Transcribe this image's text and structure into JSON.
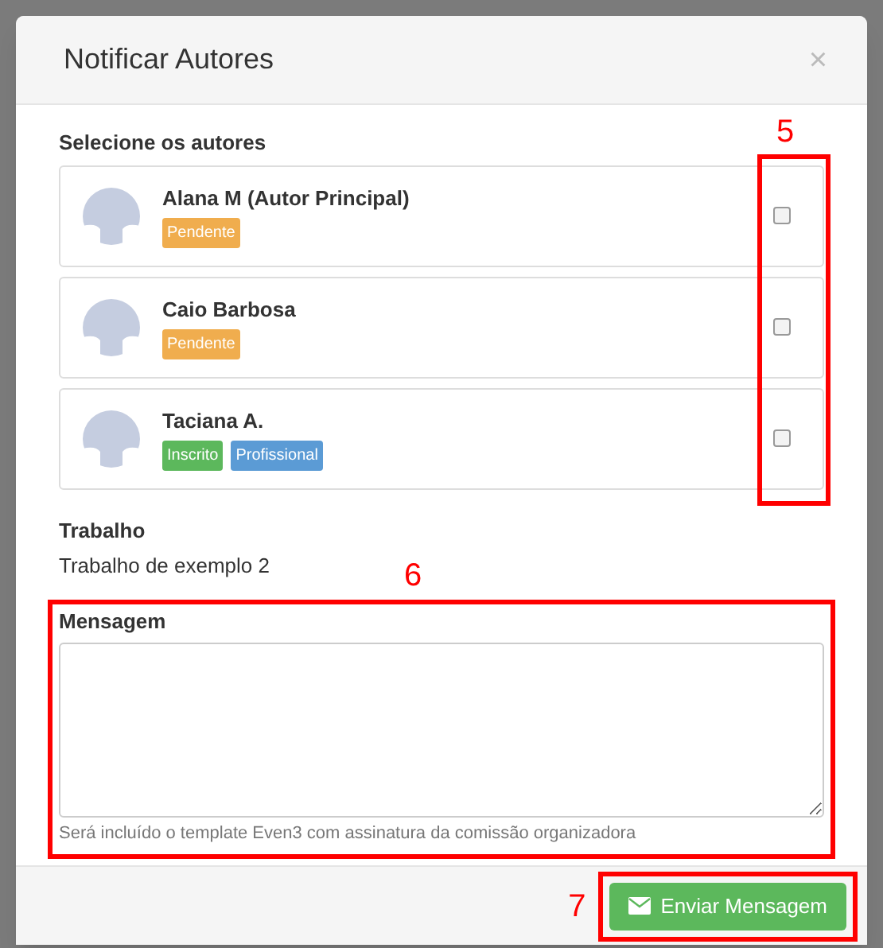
{
  "dialog": {
    "title": "Notificar Autores",
    "close": "×"
  },
  "authors_label": "Selecione os autores",
  "authors": [
    {
      "name": "Alana M (Autor Principal)",
      "checked": false,
      "tags": [
        {
          "text": "Pendente",
          "color": "#f0ad4e"
        }
      ]
    },
    {
      "name": "Caio Barbosa",
      "checked": false,
      "tags": [
        {
          "text": "Pendente",
          "color": "#f0ad4e"
        }
      ]
    },
    {
      "name": "Taciana A.",
      "checked": false,
      "tags": [
        {
          "text": "Inscrito",
          "color": "#5cb85c"
        },
        {
          "text": "Profissional",
          "color": "#5b9bd5"
        }
      ]
    }
  ],
  "work": {
    "label": "Trabalho",
    "value": "Trabalho de exemplo 2"
  },
  "message": {
    "label": "Mensagem",
    "hint": "Será incluído o template Even3 com assinatura da comissão organizadora"
  },
  "send_button": "Enviar Mensagem",
  "annotations": [
    "5",
    "6",
    "7"
  ]
}
